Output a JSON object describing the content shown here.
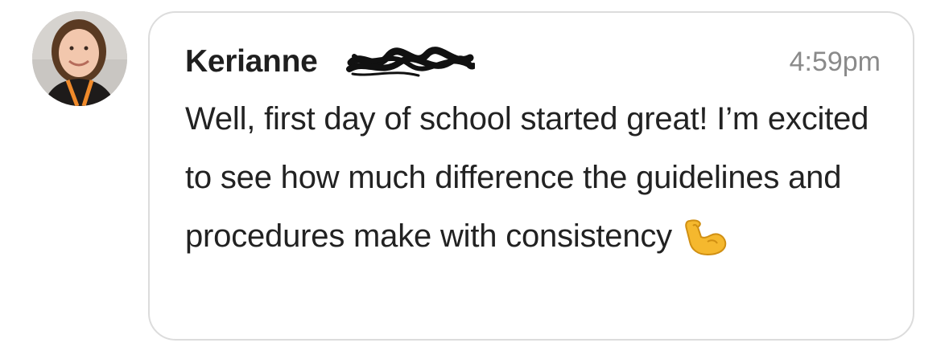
{
  "post": {
    "sender_name": "Kerianne",
    "timestamp": "4:59pm",
    "message": "Well, first day of school started great! I’m excited to see how much difference the guidelines and procedures make with consistency",
    "emoji": "flexed-biceps"
  },
  "icons": {
    "avatar": "profile-photo",
    "redaction": "scribbled-out-surname",
    "emoji": "flexed-biceps-emoji"
  },
  "colors": {
    "bubble_border": "#dcdcdc",
    "name_text": "#1f1f1f",
    "message_text": "#222222",
    "timestamp_text": "#8a8a8a",
    "emoji_yellow": "#f5b82e"
  }
}
